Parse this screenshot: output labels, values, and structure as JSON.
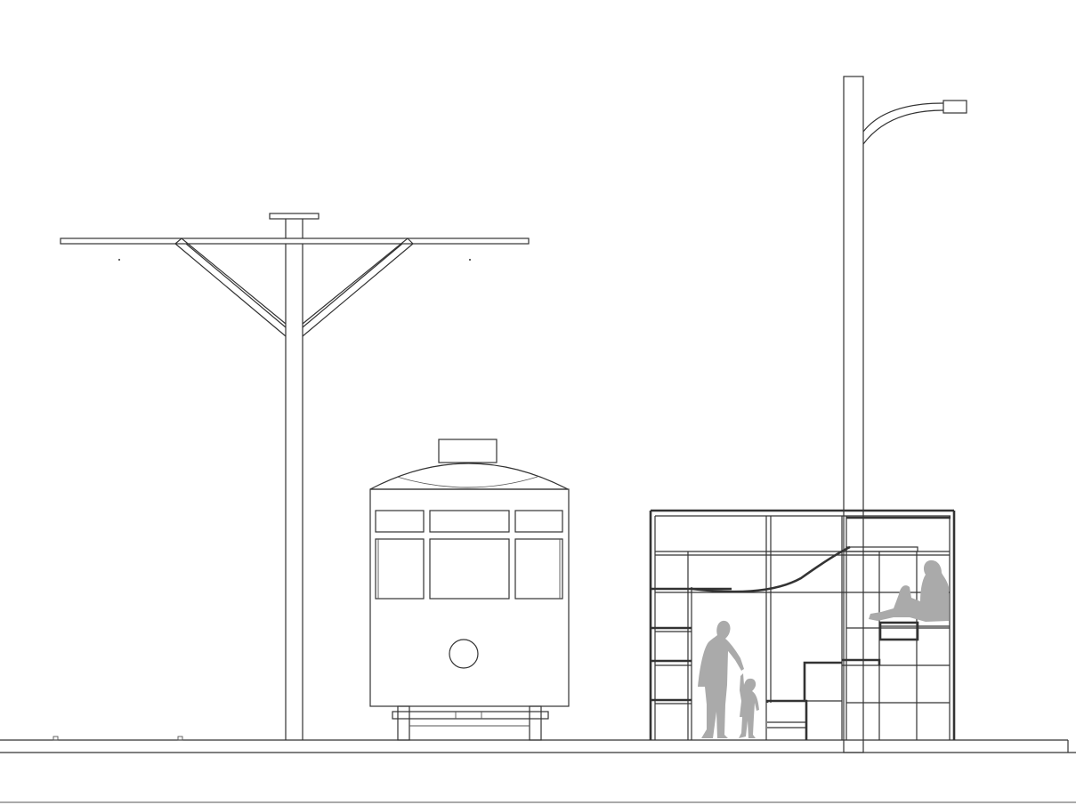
{
  "drawing": {
    "type": "street elevation line drawing",
    "colors": {
      "line": "#333333",
      "figures": "#aaaaaa",
      "background": "#ffffff"
    },
    "elements": [
      "ground-line",
      "tram-wire-pole",
      "tram-front",
      "street-lamp",
      "pavilion-frame",
      "adult-figure",
      "child-figure",
      "seated-figure"
    ]
  }
}
